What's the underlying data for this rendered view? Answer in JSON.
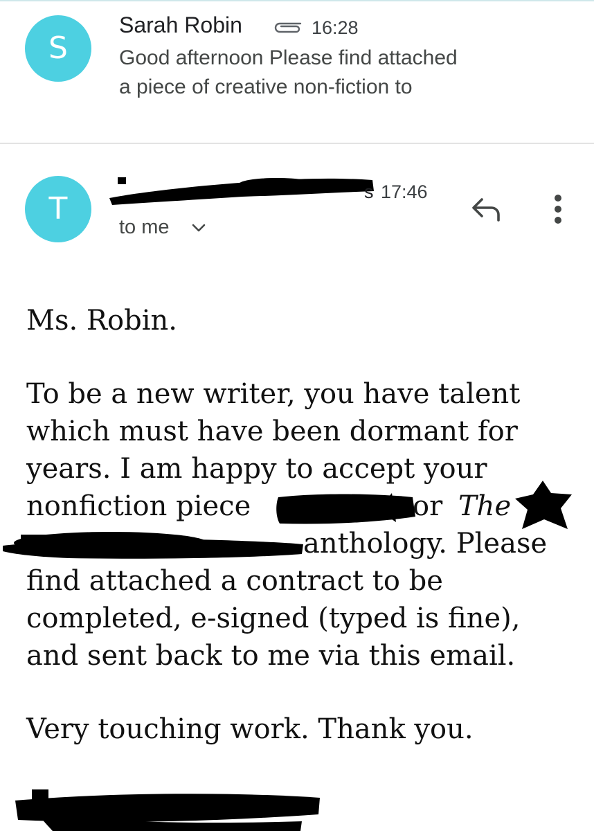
{
  "colors": {
    "avatar": "#4dd0e1",
    "redaction": "#000000",
    "divider": "#e3e3e3"
  },
  "thread": {
    "first": {
      "avatar_letter": "S",
      "sender": "Sarah Robin",
      "attachment_icon": "paperclip-icon",
      "time": "16:28",
      "snippet_line1": "Good afternoon Please find attached",
      "snippet_line2": "a piece of creative non-fiction to"
    },
    "second": {
      "avatar_letter": "T",
      "sender_visible": "s",
      "time": "17:46",
      "recipient": "to me",
      "reply_icon": "reply-icon",
      "more_icon": "more-vertical-icon",
      "body": {
        "greeting": "Ms. Robin.",
        "p1": [
          "To be a new writer, you have talent",
          "which must have been dormant for",
          "years. I am happy to accept your"
        ],
        "p1_line4_a": "nonfiction piece",
        "p1_line4_b": "or",
        "p1_line4_c": "The",
        "p1_line5": "anthology. Please",
        "p1_rest": [
          "find attached a contract to be",
          "completed, e-signed (typed is fine),",
          "and sent back to me via this email."
        ],
        "p2": "Very touching work. Thank you."
      }
    }
  }
}
